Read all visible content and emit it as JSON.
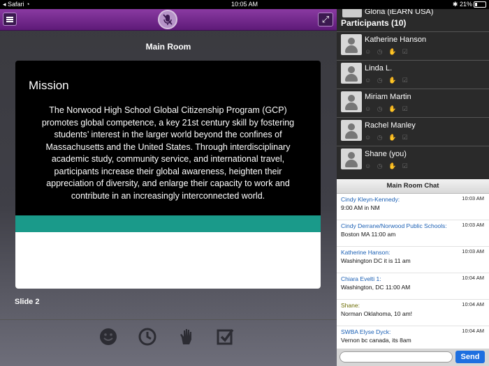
{
  "status_bar": {
    "back_app": "Safari",
    "time": "10:05 AM",
    "battery": "21%"
  },
  "main": {
    "room_title": "Main Room",
    "slide": {
      "heading": "Mission",
      "body": "The Norwood High School Global Citizenship Program (GCP) promotes global competence, a key 21st century skill by fostering students’ interest in the larger world beyond the confines of Massachusetts and the United States. Through interdisciplinary academic study, community service, and international travel, participants increase their global awareness, heighten their appreciation of diversity, and enlarge their capacity to work and contribute in an increasingly interconnected world.",
      "bar_color": "#1a9a8a"
    },
    "slide_label": "Slide 2",
    "tool_icons": [
      "smiley-icon",
      "clock-icon",
      "raise-hand-icon",
      "checkbox-icon"
    ]
  },
  "participants": {
    "partial_name": "Gloria (iEARN USA)",
    "header": "Participants (10)",
    "items": [
      {
        "name": "Katherine Hanson"
      },
      {
        "name": "Linda L."
      },
      {
        "name": "Miriam Martin"
      },
      {
        "name": "Rachel Manley"
      },
      {
        "name": "Shane (you)"
      }
    ]
  },
  "chat": {
    "title": "Main Room Chat",
    "messages": [
      {
        "author": "Cindy Kleyn-Kennedy:",
        "time": "10:03 AM",
        "text": "9:00 AM in NM",
        "color": "#1a5fb4"
      },
      {
        "author": "Cindy Derrane/Norwood Public Schools:",
        "time": "10:03 AM",
        "text": "Boston MA 11:00 am",
        "color": "#1a5fb4"
      },
      {
        "author": "Katherine Hanson:",
        "time": "10:03 AM",
        "text": "Washington DC it is 11 am",
        "color": "#1a5fb4"
      },
      {
        "author": "Chiara Evelti 1:",
        "time": "10:04 AM",
        "text": "Washington, DC 11:00 AM",
        "color": "#1a5fb4"
      },
      {
        "author": "Shane:",
        "time": "10:04 AM",
        "text": "Norman Oklahoma, 10 am!",
        "color": "#6b6b00"
      },
      {
        "author": "SWBA Elyse Dyck:",
        "time": "10:04 AM",
        "text": "Vernon bc canada, its 8am",
        "color": "#1a5fb4"
      }
    ],
    "input_value": "",
    "send_label": "Send"
  }
}
